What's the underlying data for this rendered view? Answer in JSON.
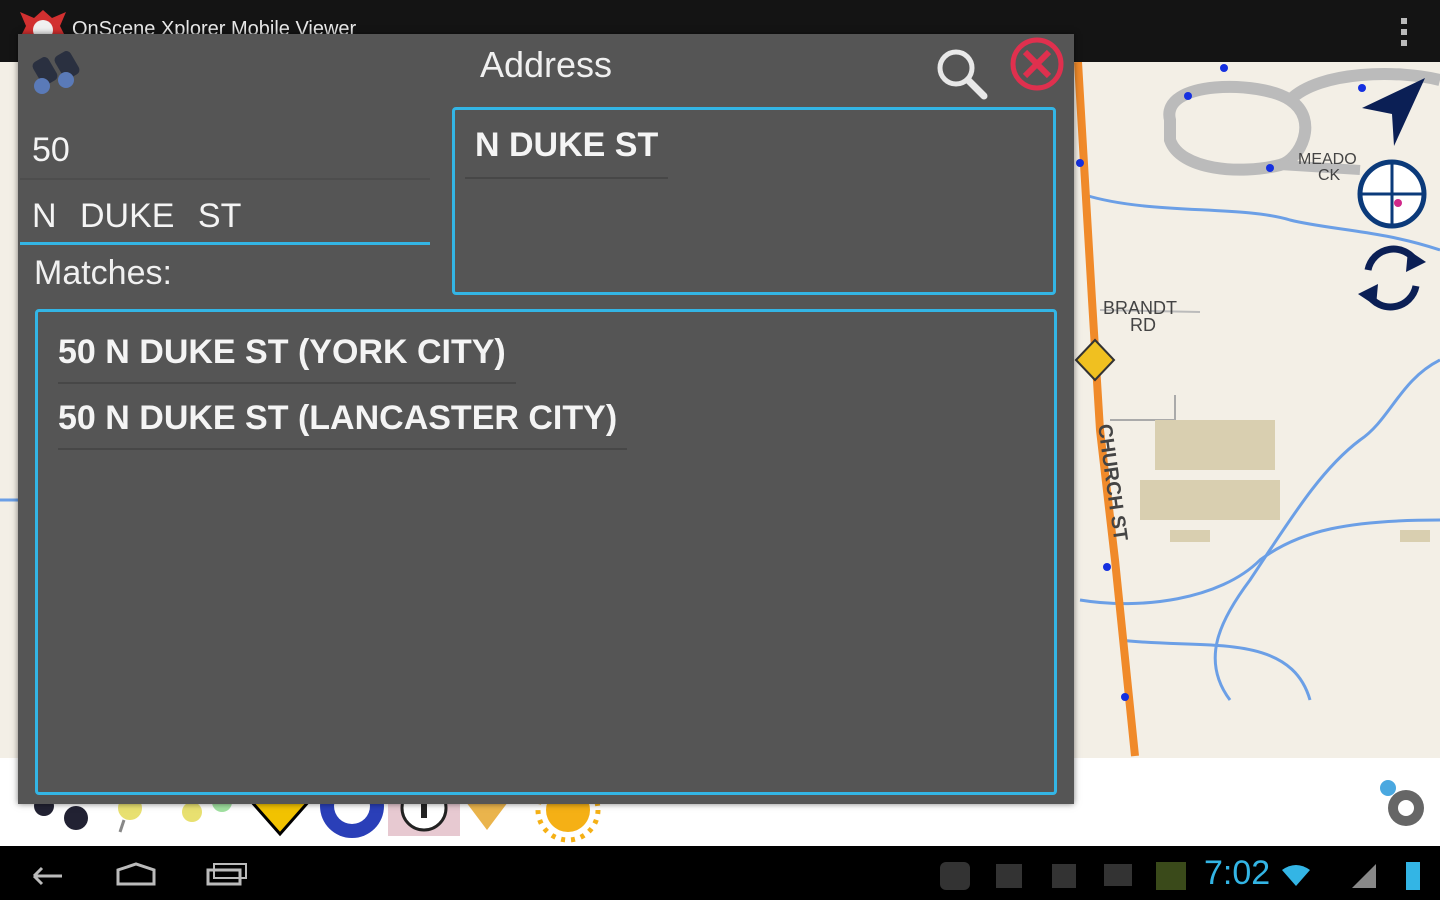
{
  "app": {
    "title": "OnScene Xplorer Mobile Viewer"
  },
  "dialog": {
    "title": "Address",
    "house_number": "50",
    "street_input": "N  DUKE  ST",
    "matches_label": "Matches:",
    "street_suggestions": [
      "N DUKE ST"
    ],
    "matches": [
      "50 N DUKE ST (YORK CITY)",
      "50 N DUKE ST (LANCASTER CITY)"
    ]
  },
  "map": {
    "labels": {
      "brandt": "BRANDT",
      "rd": "RD",
      "church": "CHURCH ST",
      "meado": "MEADO",
      "ck": "CK"
    }
  },
  "status": {
    "clock": "7:02"
  },
  "colors": {
    "accent": "#33b5e5",
    "dialog_bg": "#555555",
    "close": "#e0304e",
    "road": "#f08a2a"
  },
  "icons": [
    "app-logo-icon",
    "overflow-menu-icon",
    "binoculars-icon",
    "search-icon",
    "close-icon",
    "navigation-arrow-icon",
    "gps-target-icon",
    "refresh-icon",
    "settings-icon",
    "back-icon",
    "home-icon",
    "recent-apps-icon",
    "wifi-icon",
    "battery-icon"
  ]
}
